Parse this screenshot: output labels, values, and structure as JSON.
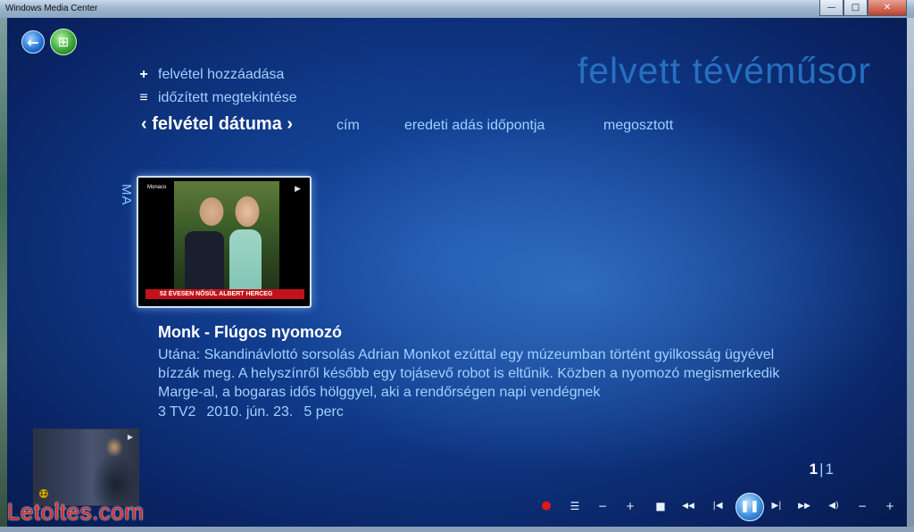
{
  "window": {
    "title": "Windows Media Center",
    "minimize_glyph": "—",
    "maximize_glyph": "□",
    "close_glyph": "✕"
  },
  "nav": {
    "back_glyph": "←",
    "start_glyph": "⊞"
  },
  "actions": [
    {
      "icon": "plus-icon",
      "glyph": "+",
      "label": "felvétel hozzáadása"
    },
    {
      "icon": "list-icon",
      "glyph": "≡",
      "label": "időzített megtekintése"
    }
  ],
  "page_title": "felvett tévéműsor",
  "tabs": {
    "active": "felvétel dátuma",
    "prev_glyph": "‹",
    "next_glyph": "›",
    "others": [
      "cím",
      "eredeti adás időpontja",
      "megosztott"
    ]
  },
  "group_label": "MA",
  "thumbnail": {
    "channel_tag": "Monaco",
    "logo": "▶",
    "ticker": "52 ÉVESEN NŐSÜL ALBERT HERCEG"
  },
  "details": {
    "title": "Monk - Flúgos nyomozó",
    "description": "Utána: Skandinávlottó sorsolás Adrian Monkot ezúttal egy múzeumban történt gyilkosság ügyével bízzák meg. A helyszínről később egy tojásevő robot is eltűnik. Közben a nyomozó megismerkedik Marge-al, a bogaras idős hölggyel, aki a rendőrségen napi vendégnek",
    "channel": "3 TV2",
    "date": "2010. jún. 23.",
    "duration": "5 perc"
  },
  "pager": {
    "current": "1",
    "total": "1",
    "separator": "|"
  },
  "mini_player": {
    "badge": "12",
    "logo": "▶"
  },
  "transport": [
    {
      "name": "record-button",
      "glyph": "●"
    },
    {
      "name": "guide-button",
      "glyph": "☰"
    },
    {
      "name": "channel-down-button",
      "glyph": "−"
    },
    {
      "name": "channel-up-button",
      "glyph": "+"
    },
    {
      "name": "stop-button",
      "glyph": "■"
    },
    {
      "name": "rewind-button",
      "glyph": "◀◀"
    },
    {
      "name": "skip-back-button",
      "glyph": "|◀"
    },
    {
      "name": "pause-button",
      "glyph": "❚❚"
    },
    {
      "name": "skip-forward-button",
      "glyph": "▶|"
    },
    {
      "name": "fast-forward-button",
      "glyph": "▶▶"
    },
    {
      "name": "mute-button",
      "glyph": "◀)"
    },
    {
      "name": "volume-down-button",
      "glyph": "−"
    },
    {
      "name": "volume-up-button",
      "glyph": "+"
    }
  ],
  "watermark": "Letoltes.com"
}
